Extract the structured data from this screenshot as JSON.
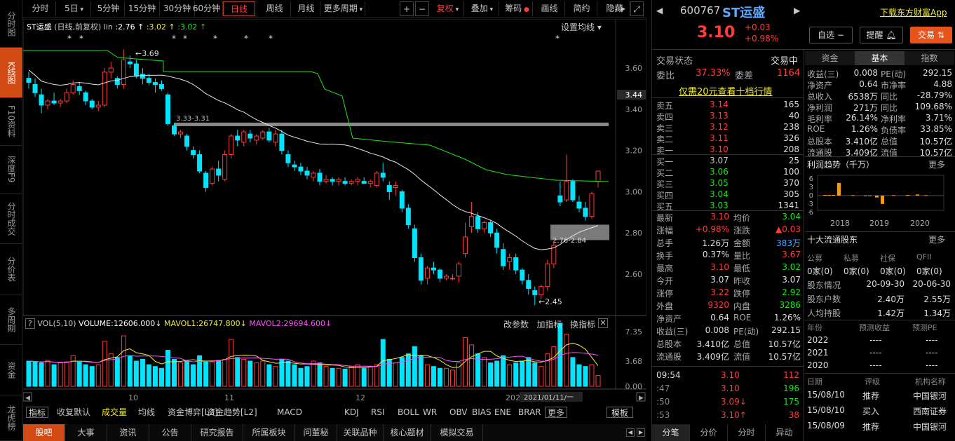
{
  "leftnav": [
    "分时图",
    "K线图",
    "F10资料",
    "深度F9",
    "分时成交",
    "分价表",
    "多周期",
    "资金",
    "龙虎榜"
  ],
  "toolbar": {
    "periods": [
      "分时",
      "5日",
      "5分钟",
      "15分钟",
      "30分钟",
      "60分钟",
      "日线",
      "周线",
      "月线",
      "更多周期"
    ],
    "right": [
      "+",
      "−",
      "复权",
      "叠加",
      "筹码",
      "画线",
      "简约",
      "隐藏"
    ]
  },
  "chart_header": {
    "name": "ST运盛",
    "mode": "(日线,前复权)",
    "lin_label": "lin",
    "lin1": ":2.76",
    "lin2": ":3.02",
    "lin3": ":3.02",
    "setting": "设置均线"
  },
  "price_axis": [
    "3.60",
    "3.40",
    "3.20",
    "3.00",
    "2.80",
    "2.60"
  ],
  "current_tag": "3.44",
  "annotations": {
    "high": "3.69",
    "low": "2.45",
    "band1": "3.33-3.31",
    "band2": "2.76-2.84"
  },
  "months": [
    "10",
    "11",
    "12",
    "2021"
  ],
  "vol_header": {
    "title": "VOL(5,10)",
    "volume": "VOLUME:12606.000",
    "ma1": "MAVOL1:26747.800",
    "ma2": "MAVOL2:29694.600",
    "links": [
      "改参数",
      "加指标",
      "换指标"
    ]
  },
  "vol_axis": [
    "7.35",
    "3.68",
    "0.00"
  ],
  "date_tag": "2021/01/11/一",
  "indicator_tabs": [
    "指标",
    "收复默认",
    "成交量",
    "均线",
    "资金博弈[L2]",
    "资金趋势[L2]",
    "MACD",
    "KDJ",
    "RSI",
    "BOLL",
    "WR",
    "OBV",
    "BIAS",
    "ENE",
    "BRAR",
    "更多",
    "模板"
  ],
  "bottom_tabs": [
    "股吧",
    "大事",
    "资讯",
    "公告",
    "研究报告",
    "所属板块",
    "问董秘",
    "关联品种",
    "核心题材",
    "模拟交易"
  ],
  "quote": {
    "code": "600767",
    "name": "ST运盛",
    "price": "3.10",
    "chg": "+0.03",
    "pct": "+0.98%",
    "download": "下载东方财富App",
    "btn_zixuan": "自选 −",
    "btn_tixing": "提醒",
    "btn_jiaoyi": "交易",
    "status_label": "交易状态",
    "status": "交易中",
    "wb_label": "委比",
    "wb": "37.33%",
    "wc_label": "委差",
    "wc": "1164",
    "tenlevel": "仅需20元查看十档行情",
    "asks": [
      {
        "l": "卖五",
        "p": "3.14",
        "v": "165"
      },
      {
        "l": "卖四",
        "p": "3.13",
        "v": "40"
      },
      {
        "l": "卖三",
        "p": "3.12",
        "v": "238"
      },
      {
        "l": "卖二",
        "p": "3.11",
        "v": "326"
      },
      {
        "l": "卖一",
        "p": "3.10",
        "v": "208"
      }
    ],
    "bids": [
      {
        "l": "买一",
        "p": "3.07",
        "v": "25"
      },
      {
        "l": "买二",
        "p": "3.06",
        "v": "100"
      },
      {
        "l": "买三",
        "p": "3.05",
        "v": "370"
      },
      {
        "l": "买四",
        "p": "3.04",
        "v": "305"
      },
      {
        "l": "买五",
        "p": "3.03",
        "v": "1341"
      }
    ],
    "stats": [
      [
        "最新",
        "3.10",
        "均价",
        "3.04"
      ],
      [
        "涨幅",
        "+0.98%",
        "涨跌",
        "▲0.03"
      ],
      [
        "总手",
        "1.26万",
        "金额",
        "383万"
      ],
      [
        "换手",
        "0.37%",
        "量比",
        "3.67"
      ],
      [
        "最高",
        "3.10",
        "最低",
        "3.02"
      ],
      [
        "今开",
        "3.07",
        "昨收",
        "3.07"
      ],
      [
        "涨停",
        "3.22",
        "跌停",
        "2.92"
      ],
      [
        "外盘",
        "9320",
        "内盘",
        "3286"
      ],
      [
        "净资产",
        "0.64",
        "ROE",
        "1.26%"
      ],
      [
        "收益(三)",
        "0.008",
        "PE(动)",
        "292.15"
      ],
      [
        "总股本",
        "3.410亿",
        "总值",
        "10.57亿"
      ],
      [
        "流通股",
        "3.409亿",
        "流值",
        "10.57亿"
      ]
    ],
    "ticks": [
      [
        "09:54",
        "3.10",
        "112"
      ],
      [
        ":47",
        "3.10",
        "196"
      ],
      [
        ":50",
        "3.09↓",
        "175"
      ],
      [
        ":53",
        "3.10↑",
        "38"
      ]
    ],
    "tick_tabs": [
      "分笔",
      "分价",
      "分时",
      "异动"
    ]
  },
  "f10": {
    "tabs": [
      "资金",
      "基本",
      "指数"
    ],
    "rows": [
      [
        "收益(三)",
        "0.008",
        "PE(动)",
        "292.15"
      ],
      [
        "净资产",
        "0.64",
        "市净率",
        "4.88"
      ],
      [
        "总收入",
        "6538万",
        "同比",
        "-28.79%"
      ],
      [
        "净利润",
        "271万",
        "同比",
        "109.68%"
      ],
      [
        "毛利率",
        "26.14%",
        "净利率",
        "3.71%"
      ],
      [
        "ROE",
        "1.26%",
        "负债率",
        "33.85%"
      ],
      [
        "总股本",
        "3.410亿",
        "总值",
        "10.57亿"
      ],
      [
        "流通股",
        "3.409亿",
        "流值",
        "10.57亿"
      ]
    ],
    "profit_title": "利润趋势（千万）",
    "more": "更多",
    "profit_axis": [
      "6",
      "3",
      "0",
      "-3",
      "-6"
    ],
    "years": [
      "2018",
      "2019",
      "2020"
    ],
    "holders_title": "十大流通股东",
    "holder_cols": [
      "公募",
      "私募",
      "社保",
      "QFII"
    ],
    "holder_vals": [
      "0家(0)",
      "0家(0)",
      "0家(0)",
      "0家(0)"
    ],
    "hrows": [
      [
        "股东情况",
        "20-09-30",
        "20-06-30"
      ],
      [
        "股东户数",
        "2.40万",
        "2.55万"
      ],
      [
        "人均持股",
        "1.42万",
        "1.34万"
      ]
    ],
    "fc_cols": [
      "年份",
      "预测收益",
      "预测PE"
    ],
    "fc_rows": [
      [
        "2022",
        "----",
        "----"
      ],
      [
        "2021",
        "----",
        "----"
      ],
      [
        "2020",
        "----",
        "----"
      ]
    ],
    "rt_cols": [
      "日期",
      "评级",
      "机构名称"
    ],
    "rt_rows": [
      [
        "15/08/10",
        "推荐",
        "中国银河"
      ],
      [
        "15/08/10",
        "买入",
        "西南证券"
      ],
      [
        "15/08/09",
        "推荐",
        "中国银河"
      ]
    ]
  },
  "chart_data": {
    "type": "candlestick",
    "title": "ST运盛",
    "ylim": [
      2.4,
      3.75
    ],
    "highlight": {
      "high": 3.69,
      "low": 2.45
    },
    "ohlc": [
      [
        3.55,
        3.58,
        3.5,
        3.53
      ],
      [
        3.52,
        3.55,
        3.46,
        3.48
      ],
      [
        3.47,
        3.5,
        3.38,
        3.42
      ],
      [
        3.42,
        3.45,
        3.4,
        3.44
      ],
      [
        3.44,
        3.48,
        3.42,
        3.43
      ],
      [
        3.43,
        3.45,
        3.41,
        3.44
      ],
      [
        3.44,
        3.5,
        3.43,
        3.48
      ],
      [
        3.48,
        3.54,
        3.47,
        3.52
      ],
      [
        3.51,
        3.53,
        3.47,
        3.49
      ],
      [
        3.48,
        3.49,
        3.42,
        3.44
      ],
      [
        3.44,
        3.45,
        3.4,
        3.41
      ],
      [
        3.41,
        3.44,
        3.39,
        3.42
      ],
      [
        3.42,
        3.6,
        3.41,
        3.58
      ],
      [
        3.58,
        3.63,
        3.55,
        3.6
      ],
      [
        3.55,
        3.56,
        3.5,
        3.52
      ],
      [
        3.52,
        3.69,
        3.5,
        3.64
      ],
      [
        3.63,
        3.66,
        3.6,
        3.62
      ],
      [
        3.62,
        3.64,
        3.55,
        3.56
      ],
      [
        3.57,
        3.6,
        3.52,
        3.55
      ],
      [
        3.55,
        3.57,
        3.52,
        3.53
      ],
      [
        3.53,
        3.55,
        3.48,
        3.52
      ],
      [
        3.52,
        3.54,
        3.49,
        3.5
      ],
      [
        3.47,
        3.48,
        3.32,
        3.33
      ],
      [
        3.32,
        3.33,
        3.27,
        3.28
      ],
      [
        3.28,
        3.3,
        3.26,
        3.29
      ],
      [
        3.27,
        3.28,
        3.2,
        3.22
      ],
      [
        3.2,
        3.22,
        3.16,
        3.18
      ],
      [
        3.18,
        3.2,
        3.09,
        3.1
      ],
      [
        3.09,
        3.1,
        3.0,
        3.02
      ],
      [
        3.04,
        3.12,
        3.03,
        3.11
      ],
      [
        3.11,
        3.15,
        3.05,
        3.08
      ],
      [
        3.06,
        3.2,
        3.05,
        3.18
      ],
      [
        3.18,
        3.28,
        3.16,
        3.27
      ],
      [
        3.27,
        3.3,
        3.22,
        3.25
      ],
      [
        3.24,
        3.3,
        3.22,
        3.29
      ],
      [
        3.28,
        3.3,
        3.24,
        3.26
      ],
      [
        3.25,
        3.28,
        3.23,
        3.27
      ],
      [
        3.26,
        3.3,
        3.25,
        3.29
      ],
      [
        3.29,
        3.31,
        3.24,
        3.25
      ],
      [
        3.24,
        3.3,
        3.22,
        3.28
      ],
      [
        3.28,
        3.3,
        3.18,
        3.2
      ],
      [
        3.18,
        3.2,
        3.12,
        3.14
      ],
      [
        3.13,
        3.15,
        3.1,
        3.12
      ],
      [
        3.12,
        3.14,
        3.08,
        3.1
      ],
      [
        3.1,
        3.12,
        3.06,
        3.08
      ],
      [
        3.07,
        3.1,
        3.05,
        3.09
      ],
      [
        3.09,
        3.11,
        3.03,
        3.05
      ],
      [
        3.05,
        3.08,
        3.04,
        3.06
      ],
      [
        3.06,
        3.07,
        3.03,
        3.05
      ],
      [
        3.05,
        3.07,
        3.03,
        3.06
      ],
      [
        3.05,
        3.07,
        3.03,
        3.04
      ],
      [
        3.04,
        3.06,
        3.03,
        3.05
      ],
      [
        3.05,
        3.07,
        3.03,
        3.06
      ],
      [
        3.05,
        3.07,
        3.04,
        3.04
      ],
      [
        3.04,
        3.06,
        3.02,
        3.05
      ],
      [
        3.03,
        3.1,
        3.02,
        3.09
      ],
      [
        3.09,
        3.14,
        3.05,
        3.07
      ],
      [
        3.03,
        3.05,
        2.96,
        3.0
      ],
      [
        3.02,
        3.05,
        2.98,
        3.03
      ],
      [
        3.0,
        3.01,
        2.9,
        2.92
      ],
      [
        2.92,
        2.94,
        2.82,
        2.84
      ],
      [
        2.82,
        2.84,
        2.66,
        2.68
      ],
      [
        2.68,
        2.7,
        2.55,
        2.57
      ],
      [
        2.58,
        2.64,
        2.55,
        2.63
      ],
      [
        2.63,
        2.66,
        2.6,
        2.62
      ],
      [
        2.62,
        2.63,
        2.56,
        2.58
      ],
      [
        2.58,
        2.6,
        2.57,
        2.59
      ],
      [
        2.58,
        2.6,
        2.57,
        2.58
      ],
      [
        2.59,
        2.66,
        2.56,
        2.65
      ],
      [
        2.7,
        2.85,
        2.68,
        2.78
      ],
      [
        2.83,
        2.95,
        2.8,
        2.88
      ],
      [
        2.88,
        2.9,
        2.8,
        2.82
      ],
      [
        2.82,
        2.86,
        2.8,
        2.85
      ],
      [
        2.85,
        2.86,
        2.78,
        2.8
      ],
      [
        2.8,
        2.82,
        2.7,
        2.73
      ],
      [
        2.72,
        2.75,
        2.62,
        2.64
      ],
      [
        2.66,
        2.7,
        2.62,
        2.68
      ],
      [
        2.68,
        2.7,
        2.6,
        2.62
      ],
      [
        2.62,
        2.63,
        2.55,
        2.57
      ],
      [
        2.57,
        2.6,
        2.5,
        2.53
      ],
      [
        2.52,
        2.54,
        2.45,
        2.5
      ],
      [
        2.5,
        2.55,
        2.48,
        2.54
      ],
      [
        2.54,
        2.67,
        2.52,
        2.65
      ],
      [
        2.65,
        2.76,
        2.63,
        2.74
      ],
      [
        2.98,
        3.05,
        2.93,
        2.95
      ],
      [
        2.96,
        3.18,
        2.95,
        3.05
      ],
      [
        3.05,
        3.06,
        2.95,
        2.96
      ],
      [
        2.95,
        2.98,
        2.9,
        2.92
      ],
      [
        2.92,
        2.95,
        2.86,
        2.88
      ],
      [
        2.88,
        3.0,
        2.87,
        2.99
      ],
      [
        3.05,
        3.1,
        3.02,
        3.1
      ]
    ],
    "vol": [
      7.0,
      6.8,
      6.5,
      7.2,
      6.0,
      6.5,
      6.8,
      8.5,
      7.0,
      6.0,
      5.5,
      6.0,
      12.5,
      9.0,
      8.0,
      14.0,
      8.5,
      7.0,
      7.5,
      6.0,
      5.5,
      5.0,
      10.0,
      7.5,
      6.5,
      7.0,
      6.0,
      8.5,
      7.0,
      6.8,
      7.2,
      7.5,
      13.0,
      8.0,
      7.5,
      7.0,
      6.5,
      7.0,
      6.0,
      5.5,
      7.5,
      7.0,
      6.0,
      5.0,
      5.5,
      7.0,
      6.5,
      5.5,
      5.0,
      5.0,
      4.8,
      5.5,
      6.0,
      5.0,
      5.5,
      6.0,
      13.0,
      7.5,
      6.5,
      8.0,
      9.0,
      11.0,
      8.5,
      6.0,
      5.5,
      5.0,
      5.0,
      4.5,
      6.5,
      13.5,
      11.5,
      9.0,
      8.0,
      6.5,
      7.0,
      8.5,
      6.0,
      6.5,
      7.0,
      8.0,
      6.5,
      5.5,
      9.0,
      11.0,
      17.5,
      14.5,
      8.0,
      6.0,
      5.5,
      6.0,
      3.0
    ],
    "vol_ylim": [
      0,
      17.5
    ]
  }
}
